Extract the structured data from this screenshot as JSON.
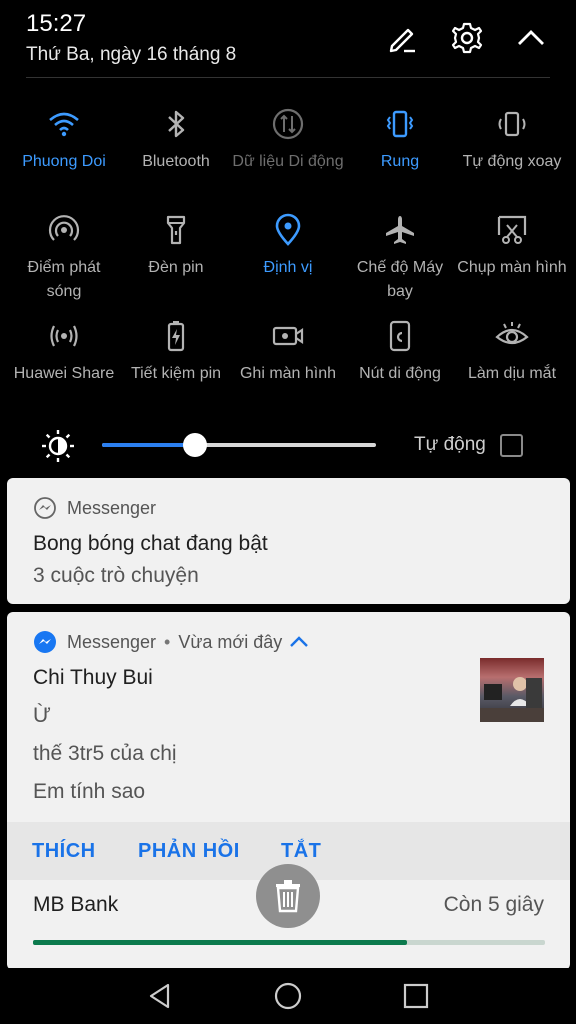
{
  "status": {
    "time": "15:27",
    "date": "Thứ Ba, ngày 16 tháng 8"
  },
  "header": {
    "edit_icon": "pencil-icon",
    "settings_icon": "gear-icon",
    "collapse_icon": "chevron-up-icon"
  },
  "quick_settings": {
    "tiles": [
      {
        "icon": "wifi-icon",
        "label": "Phuong Doi",
        "state": "active"
      },
      {
        "icon": "bluetooth-icon",
        "label": "Bluetooth",
        "state": "off"
      },
      {
        "icon": "mobile-data-icon",
        "label": "Dữ liệu Di động",
        "state": "disabled"
      },
      {
        "icon": "vibrate-icon",
        "label": "Rung",
        "state": "active"
      },
      {
        "icon": "auto-rotate-icon",
        "label": "Tự động xoay",
        "state": "off"
      },
      {
        "icon": "hotspot-icon",
        "label": "Điểm phát sóng",
        "state": "off"
      },
      {
        "icon": "flashlight-icon",
        "label": "Đèn pin",
        "state": "off"
      },
      {
        "icon": "location-icon",
        "label": "Định vị",
        "state": "active"
      },
      {
        "icon": "airplane-icon",
        "label": "Chế độ Máy bay",
        "state": "off"
      },
      {
        "icon": "screenshot-icon",
        "label": "Chụp màn hình",
        "state": "off"
      },
      {
        "icon": "huawei-share-icon",
        "label": "Huawei Share",
        "state": "off"
      },
      {
        "icon": "battery-saver-icon",
        "label": "Tiết kiệm pin",
        "state": "off"
      },
      {
        "icon": "screen-record-icon",
        "label": "Ghi màn hình",
        "state": "off"
      },
      {
        "icon": "floating-dock-icon",
        "label": "Nút di động",
        "state": "off"
      },
      {
        "icon": "eye-comfort-icon",
        "label": "Làm dịu mắt",
        "state": "off"
      }
    ]
  },
  "brightness": {
    "level": 0.34,
    "auto_label": "Tự động",
    "auto_checked": false
  },
  "notifications": {
    "bubbles": {
      "app": "Messenger",
      "title": "Bong bóng chat đang bật",
      "text": "3 cuộc trò chuyện"
    },
    "message": {
      "app": "Messenger",
      "time": "Vừa mới đây",
      "sender": "Chi Thuy Bui",
      "lines": [
        "Ừ",
        "thế 3tr5 của chị",
        "Em tính sao"
      ],
      "actions": [
        "THÍCH",
        "PHẢN HỒI",
        "TẮT"
      ]
    },
    "bank": {
      "app": "MB Bank",
      "countdown": "Còn 5 giây",
      "progress": 0.73
    }
  },
  "colors": {
    "accent": "#3d9bff",
    "action_blue": "#1a73e8",
    "progress_green": "#0c7a4d"
  }
}
